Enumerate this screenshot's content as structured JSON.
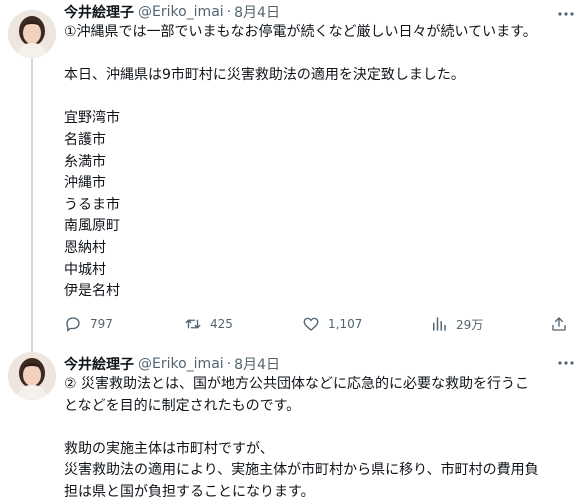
{
  "tweets": [
    {
      "author_name": "今井絵理子",
      "handle": "@Eriko_imai",
      "separator": "·",
      "date": "8月4日",
      "lines": [
        "①沖縄県では一部でいまもなお停電が続くなど厳しい日々が続いています。",
        "",
        "本日、沖縄県は9市町村に災害救助法の適用を決定致しました。",
        "",
        "宜野湾市",
        "名護市",
        "糸満市",
        "沖縄市",
        "うるま市",
        "南風原町",
        "恩納村",
        "中城村",
        "伊是名村"
      ],
      "stats": {
        "replies": "797",
        "retweets": "425",
        "likes": "1,107",
        "views": "29万"
      }
    },
    {
      "author_name": "今井絵理子",
      "handle": "@Eriko_imai",
      "separator": "·",
      "date": "8月4日",
      "lines": [
        "② 災害救助法とは、国が地方公共団体などに応急的に必要な救助を行うこ",
        "となどを目的に制定されたものです。",
        "",
        "救助の実施主体は市町村ですが、",
        "災害救助法の適用により、実施主体が市町村から県に移り、市町村の費用負",
        "担は県と国が負担することになります。"
      ]
    }
  ],
  "icons": {
    "more": "more-horizontal-icon",
    "reply": "reply-icon",
    "retweet": "retweet-icon",
    "like": "heart-icon",
    "views": "views-chart-icon",
    "share": "share-icon"
  },
  "colors": {
    "text_primary": "#0f1419",
    "text_secondary": "#536471",
    "thread_line": "#cfd9de"
  }
}
